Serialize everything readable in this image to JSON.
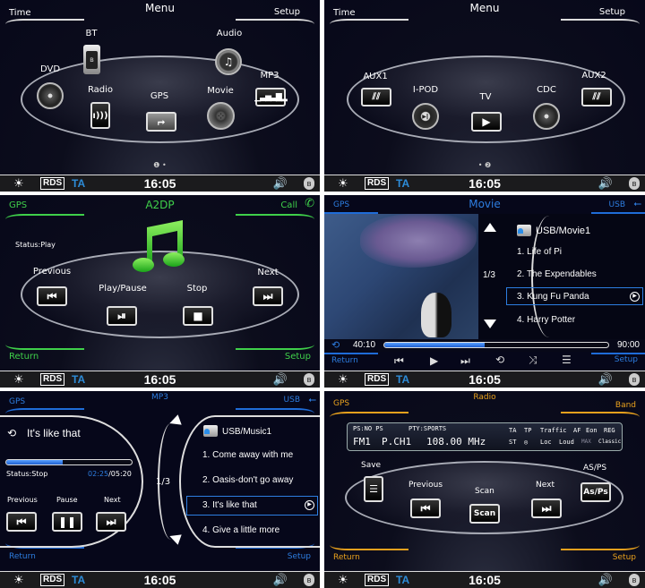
{
  "status_bar": {
    "rds_label": "RDS",
    "ta_label": "TA",
    "clock": "16:05",
    "bulb_icon": "☀",
    "volume_icon": "🔊",
    "bt_icon": "ʙ"
  },
  "menu1": {
    "title": "Menu",
    "left": "Time",
    "right": "Setup",
    "items": [
      {
        "label": "BT",
        "icon": "bluetooth-phone"
      },
      {
        "label": "Audio",
        "icon": "music-knob"
      },
      {
        "label": "DVD",
        "icon": "disc"
      },
      {
        "label": "Radio",
        "icon": "radio-signal"
      },
      {
        "label": "GPS",
        "icon": "map-route"
      },
      {
        "label": "Movie",
        "icon": "film-reel"
      },
      {
        "label": "MP3",
        "icon": "equalizer"
      }
    ],
    "page_indicator": "❶ •"
  },
  "menu2": {
    "title": "Menu",
    "left": "Time",
    "right": "Setup",
    "items": [
      {
        "label": "AUX1",
        "icon": "aux-cable"
      },
      {
        "label": "I-POD",
        "icon": "ipod-wheel"
      },
      {
        "label": "TV",
        "icon": "play"
      },
      {
        "label": "CDC",
        "icon": "cd-changer"
      },
      {
        "label": "AUX2",
        "icon": "aux-cable"
      }
    ],
    "page_indicator": "• ❷"
  },
  "a2dp": {
    "title": "A2DP",
    "top_left": "GPS",
    "top_right": "Call",
    "bottom_left": "Return",
    "bottom_right": "Setup",
    "status": "Status:Play",
    "accent": "#3fd04a",
    "controls": {
      "previous": "Previous",
      "play_pause": "Play/Pause",
      "stop": "Stop",
      "next": "Next"
    }
  },
  "movie": {
    "title": "Movie",
    "top_left": "GPS",
    "top_right": "USB",
    "bottom_left": "Return",
    "bottom_right": "Setup",
    "accent": "#2d7de0",
    "folder": "USB/Movie1",
    "page": "1/3",
    "items": [
      "1. Life of Pi",
      "2. The Expendables",
      "3. Kung Fu Panda",
      "4. Harry Potter"
    ],
    "selected_index": 2,
    "elapsed": "40:10",
    "total": "90:00",
    "progress": 0.446
  },
  "mp3": {
    "title": "MP3",
    "top_left": "GPS",
    "top_right": "USB",
    "bottom_left": "Return",
    "bottom_right": "Setup",
    "accent": "#2d7de0",
    "now_playing": "It's like that",
    "status": "Status:Stop",
    "elapsed": "02:25",
    "total": "/05:20",
    "progress": 0.45,
    "page": "1/3",
    "folder": "USB/Music1",
    "items": [
      "1. Come away with me",
      "2. Oasis-don't go away",
      "3. It's like that",
      "4. Give a little more"
    ],
    "selected_index": 2,
    "controls": {
      "previous": "Previous",
      "pause": "Pause",
      "next": "Next"
    }
  },
  "radio": {
    "title": "Radio",
    "top_left": "GPS",
    "top_right": "Band",
    "bottom_left": "Return",
    "bottom_right": "Setup",
    "accent": "#e8a11d",
    "ps": "PS:NO PS",
    "pty": "PTY:SPORTS",
    "band": "FM1",
    "preset": "P.CH1",
    "frequency": "108.00 MHz",
    "flags_row1": [
      "TA",
      "TP",
      "Traffic",
      "AF",
      "Eon",
      "REG"
    ],
    "flags_row2": [
      "ST",
      "◎",
      "Loc",
      "Loud",
      "MAX",
      "Classic"
    ],
    "controls": {
      "save": "Save",
      "previous": "Previous",
      "scan_label": "Scan",
      "scan_button": "Scan",
      "next": "Next",
      "asps_label": "AS/PS",
      "asps_button": "As/Ps"
    }
  }
}
